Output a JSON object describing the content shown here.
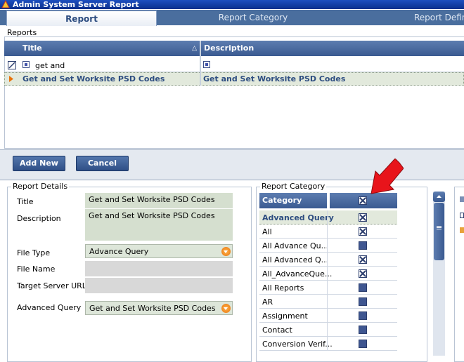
{
  "window": {
    "title": "Admin System Server Report"
  },
  "tabs": [
    {
      "label": "Report",
      "active": true
    },
    {
      "label": "Report Category",
      "active": false
    },
    {
      "label": "Report Definiti",
      "active": false
    }
  ],
  "reports": {
    "group_label": "Reports",
    "columns": [
      "Title",
      "Description"
    ],
    "filter_row": {
      "title_value": "get and",
      "description_value": ""
    },
    "rows": [
      {
        "title": "Get and Set Worksite PSD Codes",
        "description": "Get and Set Worksite PSD Codes",
        "selected": true
      }
    ]
  },
  "buttons": {
    "add_new": "Add New",
    "cancel": "Cancel"
  },
  "report_details": {
    "group_label": "Report Details",
    "title_label": "Title",
    "title_value": "Get and Set Worksite PSD Codes",
    "description_label": "Description",
    "description_value": "Get and Set Worksite PSD Codes",
    "file_type_label": "File Type",
    "file_type_value": "Advance Query",
    "file_name_label": "File Name",
    "file_name_value": "",
    "target_server_url_label": "Target Server URL",
    "target_server_url_value": "",
    "advanced_query_label": "Advanced Query",
    "advanced_query_value": "Get and Set Worksite PSD Codes"
  },
  "report_category": {
    "group_label": "Report Category",
    "column": "Category",
    "header_checked": true,
    "rows": [
      {
        "name": "Advanced Query",
        "checked": true,
        "bold": true
      },
      {
        "name": "All",
        "checked": true
      },
      {
        "name": "All Advance Qu...",
        "checked": false
      },
      {
        "name": "All Advanced Q...",
        "checked": true
      },
      {
        "name": "All_AdvanceQue...",
        "checked": true
      },
      {
        "name": "All Reports",
        "checked": false
      },
      {
        "name": "AR",
        "checked": false
      },
      {
        "name": "Assignment",
        "checked": false
      },
      {
        "name": "Contact",
        "checked": false
      },
      {
        "name": "Conversion Verif...",
        "checked": false
      }
    ]
  },
  "colors": {
    "header_blue": "#3a5a91",
    "field_green": "#d5dfcf",
    "selected_row": "#e2e9dc",
    "arrow_red": "#e8141b",
    "dropdown_orange": "#e8740e"
  }
}
